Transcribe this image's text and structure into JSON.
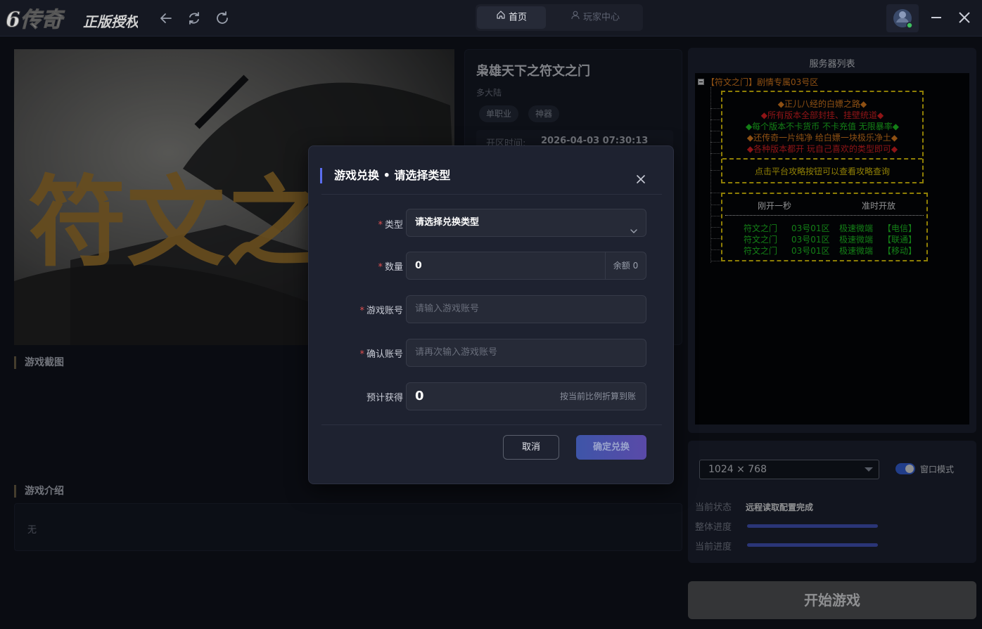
{
  "titlebar": {
    "logo_text": "6传奇",
    "logo_sub": "正版授权",
    "tabs": [
      {
        "label": "首页",
        "active": true
      },
      {
        "label": "玩家中心",
        "active": false
      }
    ]
  },
  "game": {
    "banner_text": "符文之",
    "title": "枭雄天下之符文之门",
    "region": "多大陆",
    "tags": [
      "单职业",
      "神器"
    ],
    "open_time_label": "开区时间:",
    "open_time_value": "2026-04-03 07:30:13"
  },
  "sections": {
    "screenshots_title": "游戏截图",
    "intro_title": "游戏介绍",
    "intro_text": "无"
  },
  "server_panel": {
    "title": "服务器列表",
    "root": "【符文之门】剧情专属03号区",
    "promo_lines": [
      {
        "text": "◆正儿八经的白嫖之路◆",
        "color": "#ff8c1a"
      },
      {
        "text": "◆所有版本全部封挂、挂壁统道◆",
        "color": "#ff2020"
      },
      {
        "text": "◆每个版本不卡货币 不卡充值 无限暴率◆",
        "color": "#20e020"
      },
      {
        "text": "◆还传奇一片纯净 给白嫖一块极乐净土◆",
        "color": "#ff8c1a"
      },
      {
        "text": "◆各种版本都开  玩自己喜欢的类型即可◆",
        "color": "#ff2020"
      }
    ],
    "guide_line": "点击平台攻略按钮可以查看攻略查询",
    "open_header_left": "刚开一秒",
    "open_header_right": "准时开放",
    "servers": [
      {
        "name": "符文之门",
        "zone": "03号01区",
        "speed": "极速微端",
        "line": "【电信】"
      },
      {
        "name": "符文之门",
        "zone": "03号01区",
        "speed": "极速微端",
        "line": "【联通】"
      },
      {
        "name": "符文之门",
        "zone": "03号01区",
        "speed": "极速微端",
        "line": "【移动】"
      }
    ]
  },
  "settings": {
    "resolution": "1024 × 768",
    "window_mode_label": "窗口模式",
    "window_mode_on": true,
    "status_label": "当前状态",
    "status_value": "远程读取配置完成",
    "overall_progress_label": "整体进度",
    "overall_progress": 1.0,
    "current_progress_label": "当前进度",
    "current_progress": 1.0
  },
  "start_button": "开始游戏",
  "modal": {
    "title": "游戏兑换 • 请选择类型",
    "type_label": "类型",
    "type_value": "请选择兑换类型",
    "qty_label": "数量",
    "qty_value": "0",
    "qty_balance": "余额 0",
    "account_label": "游戏账号",
    "account_placeholder": "请输入游戏账号",
    "confirm_label": "确认账号",
    "confirm_placeholder": "请再次输入游戏账号",
    "estimate_label": "预计获得",
    "estimate_value": "0",
    "estimate_hint": "按当前比例折算到账",
    "cancel": "取消",
    "submit": "确定兑换"
  },
  "colors": {
    "accent": "#5b6ef0",
    "progress": "#4a5bd0",
    "required": "#e05050"
  }
}
